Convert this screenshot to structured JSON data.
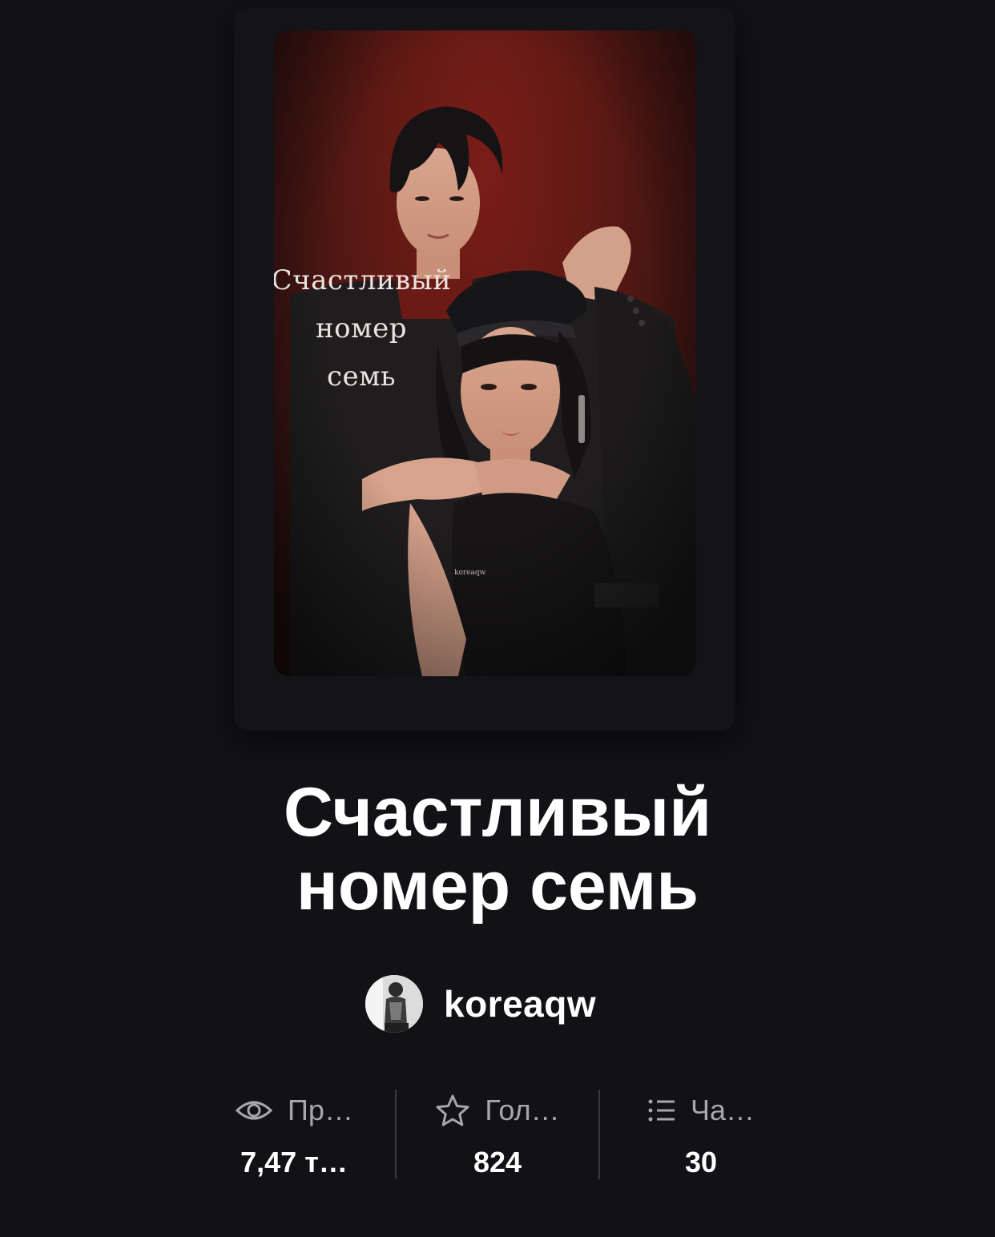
{
  "cover": {
    "title_lines": [
      "Счастливый",
      "номер",
      "семь"
    ],
    "watermark": "koreaqw"
  },
  "book": {
    "title_lines": [
      "Счастливый",
      "номер семь"
    ]
  },
  "author": {
    "name": "koreaqw"
  },
  "stats": [
    {
      "icon": "eye-icon",
      "label": "Пр…",
      "value": "7,47 т…"
    },
    {
      "icon": "star-icon",
      "label": "Гол…",
      "value": "824"
    },
    {
      "icon": "list-icon",
      "label": "Ча…",
      "value": "30"
    }
  ],
  "colors": {
    "background": "#121115",
    "cover_red": "#5e1914",
    "muted_text": "#a6a6ab",
    "divider": "#3a393f"
  }
}
